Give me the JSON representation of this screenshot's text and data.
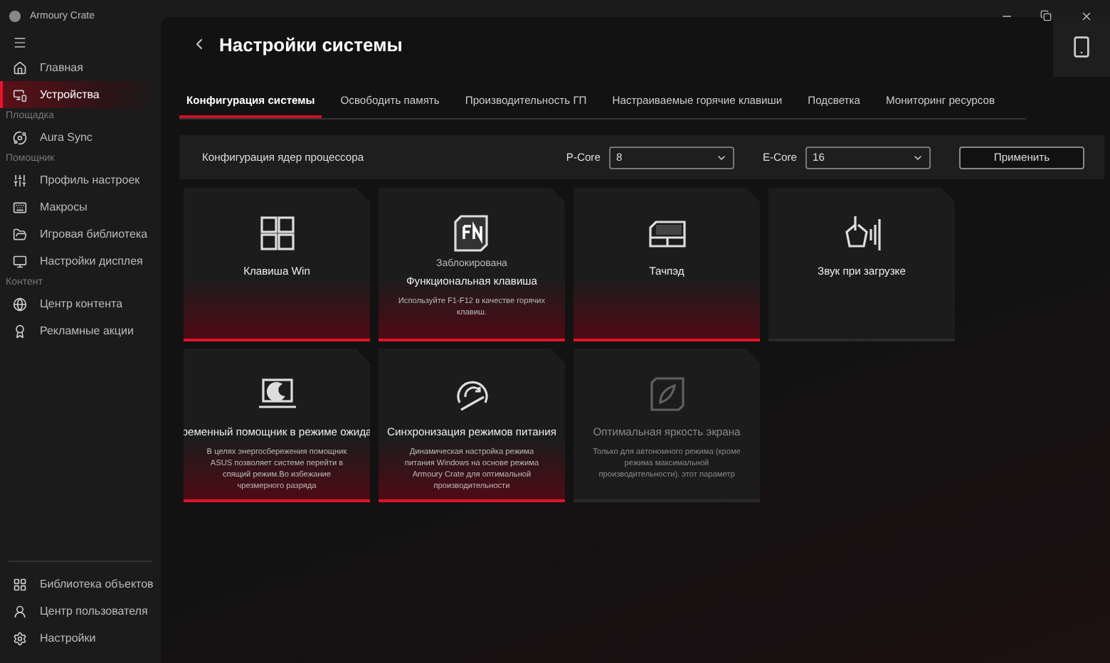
{
  "window": {
    "title": "Armoury Crate"
  },
  "sidebar": {
    "items": [
      {
        "kind": "item",
        "label": "Главная",
        "selected": false
      },
      {
        "kind": "item",
        "label": "Устройства",
        "selected": true
      },
      {
        "kind": "section",
        "label": "Площадка"
      },
      {
        "kind": "item",
        "label": "Aura Sync",
        "selected": false
      },
      {
        "kind": "section",
        "label": "Помощник"
      },
      {
        "kind": "item",
        "label": "Профиль настроек",
        "selected": false
      },
      {
        "kind": "item",
        "label": "Макросы",
        "selected": false
      },
      {
        "kind": "item",
        "label": "Игровая библиотека",
        "selected": false
      },
      {
        "kind": "item",
        "label": "Настройки дисплея",
        "selected": false
      },
      {
        "kind": "section",
        "label": "Контент"
      },
      {
        "kind": "item",
        "label": "Центр контента",
        "selected": false
      },
      {
        "kind": "item",
        "label": "Рекламные акции",
        "selected": false
      }
    ],
    "bottom_items": [
      {
        "label": "Библиотека объектов",
        "selected": false
      },
      {
        "label": "Центр пользователя",
        "selected": false
      },
      {
        "label": "Настройки",
        "selected": false
      }
    ]
  },
  "page": {
    "title": "Настройки системы"
  },
  "tabs": [
    {
      "label": "Конфигурация системы",
      "selected": true
    },
    {
      "label": "Освободить память",
      "selected": false
    },
    {
      "label": "Производительность ГП",
      "selected": false
    },
    {
      "label": "Настраиваемые горячие клавиши",
      "selected": false
    },
    {
      "label": "Подсветка",
      "selected": false
    },
    {
      "label": "Мониторинг ресурсов",
      "selected": false
    }
  ],
  "core_config": {
    "label": "Конфигурация ядер процессора",
    "p_core_label": "P-Core",
    "p_core_value": "8",
    "e_core_label": "E-Core",
    "e_core_value": "16",
    "apply": "Применить"
  },
  "cards": [
    {
      "title": "Клавиша Win",
      "on": true,
      "disabled": false
    },
    {
      "status": "Заблокирована",
      "title": "Функциональная клавиша",
      "description": "Используйте F1-F12 в качестве горячих клавиш.",
      "on": true,
      "disabled": false
    },
    {
      "title": "Тачпэд",
      "on": true,
      "disabled": false
    },
    {
      "title": "Звук при загрузке",
      "on": false,
      "disabled": false
    },
    {
      "title": "ременный помощник в режиме ожида",
      "description": "В целях энергосбережения помощник ASUS позволяет системе перейти в спящий режим.Во избежание чрезмерного разряда",
      "on": true,
      "disabled": false
    },
    {
      "title": "Синхронизация режимов питания",
      "description": "Динамическая настройка режима питания Windows на основе режима Armoury Crate для оптимальной производительности",
      "on": true,
      "disabled": false
    },
    {
      "title": "Оптимальная яркость экрана",
      "description": "Только для автономного режима (кроме режима максимальной производительности). этот параметр",
      "on": false,
      "disabled": true
    }
  ]
}
